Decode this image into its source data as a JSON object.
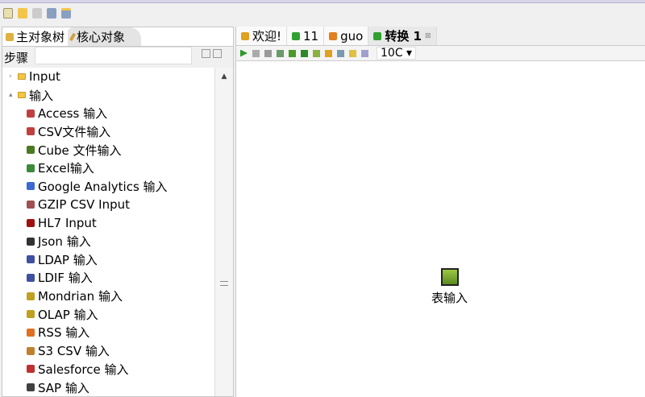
{
  "toolbar": {
    "icons": [
      "new-file-icon",
      "open-folder-icon",
      "explore-icon",
      "save-icon",
      "save-as-icon"
    ]
  },
  "left_panel": {
    "tabs": [
      {
        "label": "主对象树"
      },
      {
        "label": "核心对象"
      }
    ],
    "search_label": "步骤",
    "search_value": "",
    "tree": {
      "folders": [
        {
          "label": "Input",
          "expanded": false
        },
        {
          "label": "输入",
          "expanded": true
        }
      ],
      "items": [
        {
          "label": "Access 输入",
          "color": "#c04040"
        },
        {
          "label": "CSV文件输入",
          "color": "#c04040"
        },
        {
          "label": "Cube 文件输入",
          "color": "#4a7a20"
        },
        {
          "label": "Excel输入",
          "color": "#3a8a3a"
        },
        {
          "label": "Google Analytics 输入",
          "color": "#3a6ad0"
        },
        {
          "label": "GZIP CSV Input",
          "color": "#a05050"
        },
        {
          "label": "HL7 Input",
          "color": "#a01010"
        },
        {
          "label": "Json 输入",
          "color": "#333333"
        },
        {
          "label": "LDAP 输入",
          "color": "#4050a0"
        },
        {
          "label": "LDIF 输入",
          "color": "#4050a0"
        },
        {
          "label": "Mondrian 输入",
          "color": "#c0a020"
        },
        {
          "label": "OLAP 输入",
          "color": "#c0a020"
        },
        {
          "label": "RSS 输入",
          "color": "#e07020"
        },
        {
          "label": "S3 CSV 输入",
          "color": "#c08030"
        },
        {
          "label": "Salesforce 输入",
          "color": "#c03030"
        },
        {
          "label": "SAP 输入",
          "color": "#404040"
        }
      ]
    }
  },
  "editor": {
    "tabs": [
      {
        "label": "欢迎!",
        "color": "#e0a020"
      },
      {
        "label": "11",
        "color": "#30a030"
      },
      {
        "label": "guo",
        "color": "#e08020"
      },
      {
        "label": "转换 1",
        "color": "#30a030",
        "active": true
      }
    ],
    "zoom": "10C",
    "steps": [
      {
        "label": "表输入"
      }
    ]
  }
}
